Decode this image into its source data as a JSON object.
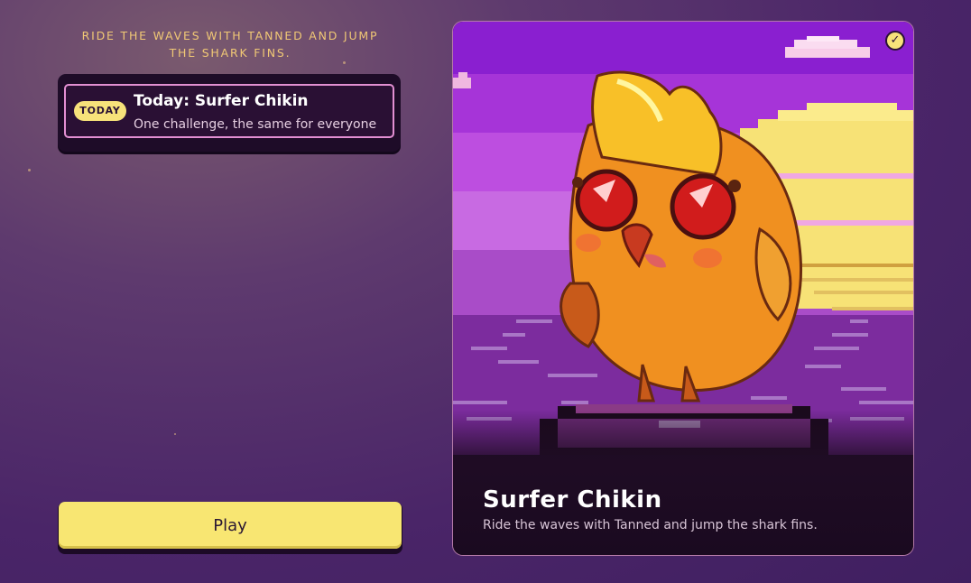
{
  "tagline": "RIDE THE WAVES WITH TANNED AND JUMP THE SHARK FINS.",
  "today": {
    "badge": "TODAY",
    "title": "Today: Surfer Chikin",
    "subtitle": "One challenge, the same for everyone"
  },
  "play_label": "Play",
  "card": {
    "title": "Surfer Chikin",
    "description": "Ride the waves with Tanned and jump the shark fins.",
    "selected_icon": "check-icon"
  },
  "colors": {
    "accent_yellow": "#f8e672",
    "today_border": "#e28fd2",
    "tagline": "#f0c875"
  }
}
